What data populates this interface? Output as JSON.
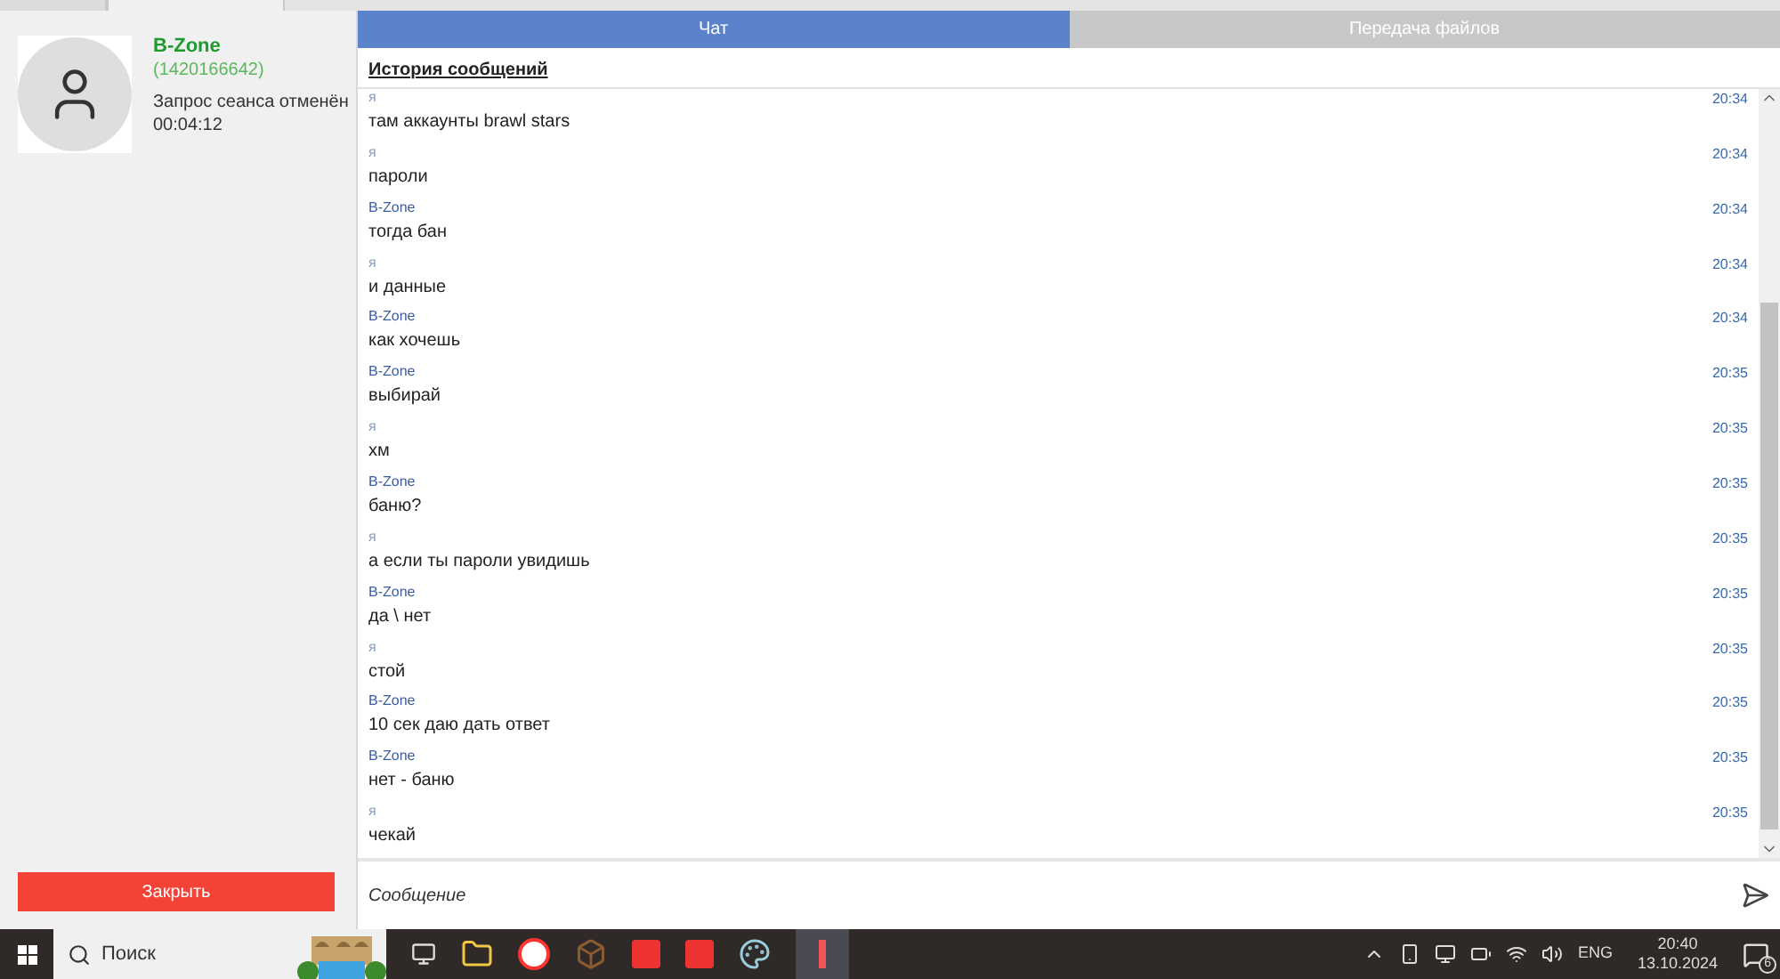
{
  "contact": {
    "name": "B-Zone",
    "id": "(1420166642)",
    "status": "Запрос сеанса отменён",
    "duration": "00:04:12"
  },
  "close_button": "Закрыть",
  "tabs": [
    {
      "label": "Чат",
      "selected": true
    },
    {
      "label": "Передача файлов",
      "selected": false
    }
  ],
  "history_title": "История сообщений",
  "messages": [
    {
      "sender": "я",
      "text": "там аккаунты brawl stars",
      "time": "20:34"
    },
    {
      "sender": "я",
      "text": "пароли",
      "time": "20:34"
    },
    {
      "sender": "B-Zone",
      "text": "тогда бан",
      "time": "20:34"
    },
    {
      "sender": "я",
      "text": "и данные",
      "time": "20:34"
    },
    {
      "sender": "B-Zone",
      "text": "как хочешь",
      "time": "20:34"
    },
    {
      "sender": "B-Zone",
      "text": "выбирай",
      "time": "20:35"
    },
    {
      "sender": "я",
      "text": "хм",
      "time": "20:35"
    },
    {
      "sender": "B-Zone",
      "text": "баню?",
      "time": "20:35"
    },
    {
      "sender": "я",
      "text": "а если ты пароли увидишь",
      "time": "20:35"
    },
    {
      "sender": "B-Zone",
      "text": "да \\ нет",
      "time": "20:35"
    },
    {
      "sender": "я",
      "text": "стой",
      "time": "20:35"
    },
    {
      "sender": "B-Zone",
      "text": "10 сек даю дать ответ",
      "time": "20:35"
    },
    {
      "sender": "B-Zone",
      "text": "нет - баню",
      "time": "20:35"
    },
    {
      "sender": "я",
      "text": "чекай",
      "time": "20:35"
    }
  ],
  "message_field": {
    "placeholder": "Сообщение"
  },
  "taskbar": {
    "search_placeholder": "Поиск",
    "language": "ENG",
    "time": "20:40",
    "date": "13.10.2024",
    "notifications": "6"
  }
}
